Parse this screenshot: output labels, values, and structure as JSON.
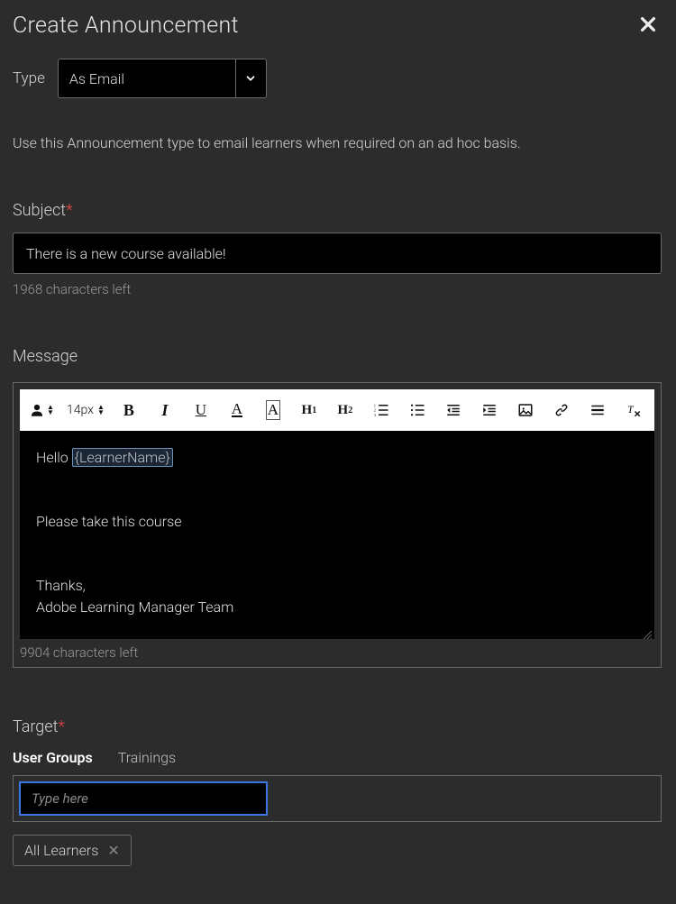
{
  "header": {
    "title": "Create Announcement"
  },
  "type": {
    "label": "Type",
    "value": "As Email",
    "description": "Use this Announcement type to email learners when required on an ad hoc basis."
  },
  "subject": {
    "label": "Subject",
    "value": "There is a new course available!",
    "helper": "1968 characters left"
  },
  "message": {
    "label": "Message",
    "fontsize": "14px",
    "line1_prefix": "Hello ",
    "line1_token": "{LearnerName}",
    "line2": "Please take this course",
    "line3": "Thanks,",
    "line4": "Adobe Learning Manager Team",
    "helper": "9904 characters left"
  },
  "target": {
    "label": "Target",
    "tabs": {
      "user_groups": "User Groups",
      "trainings": "Trainings"
    },
    "placeholder": "Type here",
    "chip": "All Learners"
  }
}
